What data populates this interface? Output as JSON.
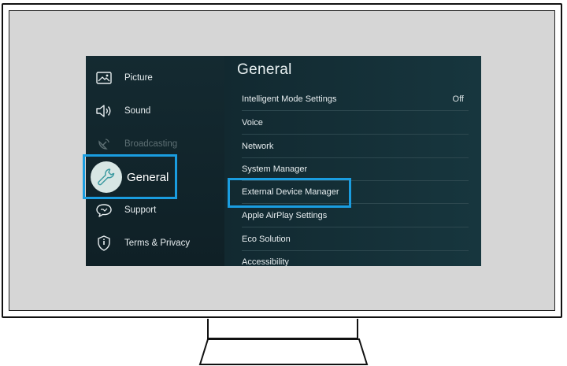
{
  "sidebar": {
    "items": [
      {
        "label": "Picture",
        "icon": "picture-icon",
        "state": "normal"
      },
      {
        "label": "Sound",
        "icon": "speaker-icon",
        "state": "normal"
      },
      {
        "label": "Broadcasting",
        "icon": "satellite-icon",
        "state": "disabled"
      },
      {
        "label": "General",
        "icon": "wrench-icon",
        "state": "selected"
      },
      {
        "label": "Support",
        "icon": "support-chat-icon",
        "state": "normal"
      },
      {
        "label": "Terms & Privacy",
        "icon": "shield-icon",
        "state": "normal"
      }
    ]
  },
  "main": {
    "title": "General",
    "items": [
      {
        "label": "Intelligent Mode Settings",
        "value": "Off"
      },
      {
        "label": "Voice"
      },
      {
        "label": "Network"
      },
      {
        "label": "System Manager"
      },
      {
        "label": "External Device Manager"
      },
      {
        "label": "Apple AirPlay Settings"
      },
      {
        "label": "Eco Solution"
      },
      {
        "label": "Accessibility"
      }
    ]
  },
  "highlights": {
    "color": "#1a9de0",
    "targets": [
      "General",
      "External Device Manager"
    ]
  }
}
